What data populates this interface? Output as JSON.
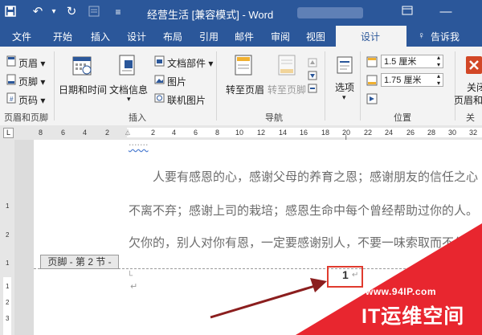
{
  "title": {
    "document_name": "经营生活 [兼容模式] - Word"
  },
  "tabs": {
    "file": "文件",
    "home": "开始",
    "insert": "插入",
    "design": "设计",
    "layout": "布局",
    "references": "引用",
    "mailings": "邮件",
    "review": "审阅",
    "view": "视图",
    "active": "设计",
    "tell_me": "告诉我"
  },
  "ribbon": {
    "header": "页眉",
    "footer": "页脚",
    "page_number": "页码",
    "group_header_footer": "页眉和页脚",
    "date_time": "日期和时间",
    "doc_info": "文档信息",
    "quick_parts": "文档部件",
    "picture": "图片",
    "online_picture": "联机图片",
    "group_insert": "插入",
    "goto_header": "转至页眉",
    "goto_footer": "转至页脚",
    "group_navigation": "导航",
    "options": "选项",
    "header_top_value": "1.5 厘米",
    "footer_bottom_value": "1.75 厘米",
    "group_position": "位置",
    "close_label_1": "关闭",
    "close_label_2": "页眉和页",
    "group_close": "关闭"
  },
  "ruler": {
    "left_ticks": [
      "8",
      "6",
      "4",
      "2"
    ],
    "right_ticks": [
      "2",
      "4",
      "6",
      "8",
      "10",
      "12",
      "14",
      "16",
      "18",
      "20",
      "22",
      "24",
      "26",
      "28",
      "30",
      "32"
    ],
    "vertical_ticks": [
      "1",
      "2",
      "1",
      "1",
      "2",
      "3"
    ]
  },
  "document": {
    "partial_line": "······· ",
    "line1": "人要有感恩的心，感谢父母的养育之恩；感谢朋友的信任之心",
    "line2": "不离不弃；感谢上司的栽培；感恩生命中每个曾经帮助过你的人。",
    "line3": "欠你的，别人对你有恩，一定要感谢别人，不要一味索取而不付出",
    "footer_label": "页脚 - 第 2 节 -",
    "page_number": "1"
  },
  "watermark": {
    "url": "www.94IP.com",
    "text": "IT运维空间"
  },
  "colors": {
    "accent": "#2b579a",
    "highlight": "#e03b2e",
    "watermark": "#e8262f"
  }
}
